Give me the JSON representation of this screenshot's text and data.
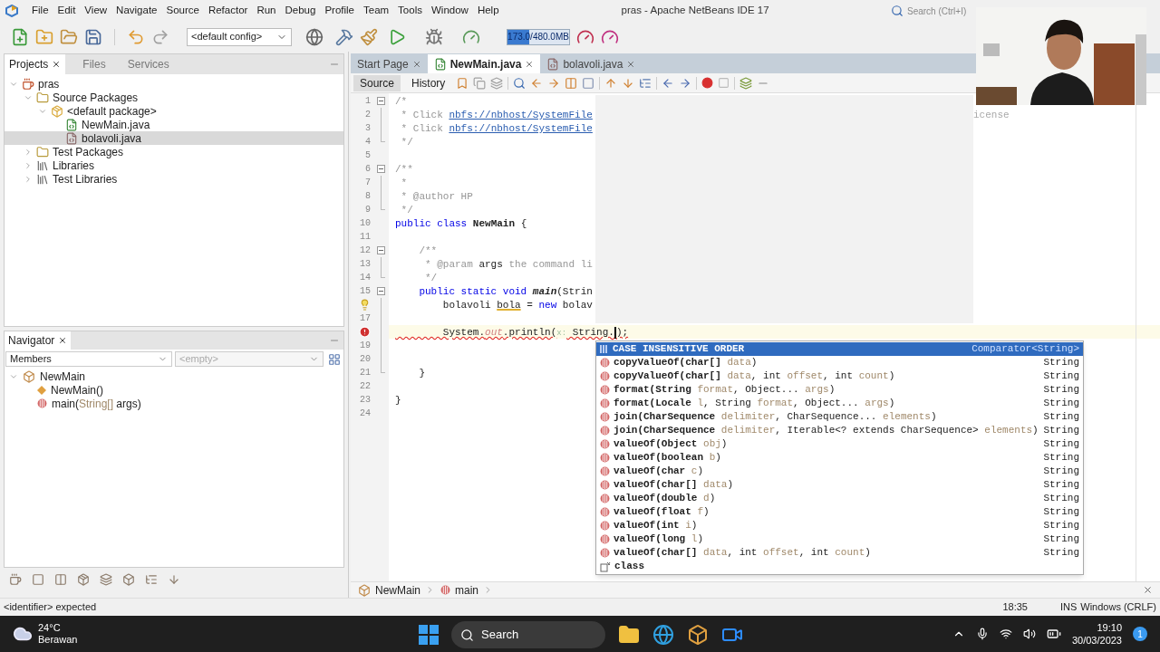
{
  "menu": [
    "File",
    "Edit",
    "View",
    "Navigate",
    "Source",
    "Refactor",
    "Run",
    "Debug",
    "Profile",
    "Team",
    "Tools",
    "Window",
    "Help"
  ],
  "title": "pras - Apache NetBeans IDE 17",
  "search": {
    "placeholder": "Search (Ctrl+I)"
  },
  "toolbar": {
    "config": "<default config>",
    "memory": {
      "text": "173.0/480.0MB",
      "level": 0.36
    }
  },
  "projects": {
    "tabs": [
      {
        "label": "Projects",
        "selected": true
      },
      {
        "label": "Files",
        "selected": false
      },
      {
        "label": "Services",
        "selected": false
      }
    ],
    "tree": [
      {
        "label": "pras",
        "kind": "project",
        "expanded": true,
        "selected": false,
        "children": [
          {
            "label": "Source Packages",
            "kind": "folder",
            "expanded": true,
            "selected": false,
            "children": [
              {
                "label": "<default package>",
                "kind": "package",
                "expanded": true,
                "selected": false,
                "children": [
                  {
                    "label": "NewMain.java",
                    "kind": "mainfile",
                    "selected": false
                  },
                  {
                    "label": "bolavoli.java",
                    "kind": "file",
                    "selected": true
                  }
                ]
              }
            ]
          },
          {
            "label": "Test Packages",
            "kind": "folder",
            "expanded": false,
            "selected": false
          },
          {
            "label": "Libraries",
            "kind": "library",
            "expanded": false,
            "selected": false
          },
          {
            "label": "Test Libraries",
            "kind": "library",
            "expanded": false,
            "selected": false
          }
        ]
      }
    ]
  },
  "navigator": {
    "title": "Navigator",
    "members": {
      "value": "Members",
      "disabled": false
    },
    "filter": {
      "value": "<empty>",
      "disabled": true
    },
    "tree": [
      {
        "parts": [
          {
            "t": "NewMain"
          }
        ],
        "kind": "class",
        "expanded": true,
        "children": [
          {
            "parts": [
              {
                "t": "NewMain()"
              }
            ],
            "kind": "constructor"
          },
          {
            "parts": [
              {
                "t": "main("
              },
              {
                "p": "String[]"
              },
              {
                "t": " args)"
              }
            ],
            "kind": "method"
          }
        ]
      }
    ]
  },
  "editor": {
    "tabs": [
      {
        "label": "Start Page",
        "kind": "page",
        "selected": false
      },
      {
        "label": "NewMain.java",
        "kind": "mainfile",
        "selected": true
      },
      {
        "label": "bolavoli.java",
        "kind": "file",
        "selected": false
      }
    ],
    "views": [
      {
        "label": "Source",
        "selected": true
      },
      {
        "label": "History",
        "selected": false
      }
    ],
    "lines": [
      {
        "number": "1",
        "fold": {
          "kind": "start"
        },
        "current": false,
        "tokens": [
          {
            "kind": "comment",
            "text": "/*"
          }
        ]
      },
      {
        "number": "2",
        "fold": {
          "kind": "line"
        },
        "current": false,
        "tokens": [
          {
            "kind": "comment",
            "text": " * Click "
          },
          {
            "kind": "link",
            "text": "nbfs://nbhost/SystemFile"
          }
        ],
        "tail": "icense"
      },
      {
        "number": "3",
        "fold": {
          "kind": "line"
        },
        "current": false,
        "tokens": [
          {
            "kind": "comment",
            "text": " * Click "
          },
          {
            "kind": "link",
            "text": "nbfs://nbhost/SystemFile"
          }
        ]
      },
      {
        "number": "4",
        "fold": {
          "kind": "end"
        },
        "current": false,
        "tokens": [
          {
            "kind": "comment",
            "text": " */"
          }
        ]
      },
      {
        "number": "5",
        "current": false
      },
      {
        "number": "6",
        "fold": {
          "kind": "start"
        },
        "current": false,
        "tokens": [
          {
            "kind": "comment",
            "text": "/**"
          }
        ]
      },
      {
        "number": "7",
        "fold": {
          "kind": "line"
        },
        "current": false,
        "tokens": [
          {
            "kind": "comment",
            "text": " *"
          }
        ]
      },
      {
        "number": "8",
        "fold": {
          "kind": "line"
        },
        "current": false,
        "tokens": [
          {
            "kind": "comment",
            "text": " * @author HP"
          }
        ]
      },
      {
        "number": "9",
        "fold": {
          "kind": "end"
        },
        "current": false,
        "tokens": [
          {
            "kind": "comment",
            "text": " */"
          }
        ]
      },
      {
        "number": "10",
        "current": false,
        "tokens": [
          {
            "kind": "keyword",
            "text": "public class "
          },
          {
            "kind": "bold",
            "text": "NewMain"
          },
          {
            "kind": "plain",
            "text": " {"
          }
        ]
      },
      {
        "number": "11",
        "current": false
      },
      {
        "number": "12",
        "fold": {
          "kind": "start"
        },
        "current": false,
        "tokens": [
          {
            "kind": "comment",
            "text": "    /**"
          }
        ]
      },
      {
        "number": "13",
        "fold": {
          "kind": "line"
        },
        "current": false,
        "tokens": [
          {
            "kind": "comment",
            "text": "     * @param "
          },
          {
            "kind": "plain",
            "text": "args"
          },
          {
            "kind": "comment",
            "text": " the command li"
          }
        ]
      },
      {
        "number": "14",
        "fold": {
          "kind": "end"
        },
        "current": false,
        "tokens": [
          {
            "kind": "comment",
            "text": "     */"
          }
        ]
      },
      {
        "number": "15",
        "fold": {
          "kind": "start"
        },
        "current": false,
        "tokens": [
          {
            "kind": "keyword",
            "text": "    public static void "
          },
          {
            "kind": "declaration",
            "text": "main"
          },
          {
            "kind": "plain",
            "text": "(Strin"
          }
        ]
      },
      {
        "marker": {
          "kind": "hint"
        },
        "fold": {
          "kind": "line"
        },
        "current": false,
        "tokens": [
          {
            "kind": "plain",
            "text": "        bolavoli "
          },
          {
            "kind": "unused",
            "text": "bola"
          },
          {
            "kind": "plain",
            "text": " = "
          },
          {
            "kind": "keyword",
            "text": "new"
          },
          {
            "kind": "plain",
            "text": " bolav"
          }
        ]
      },
      {
        "number": "17",
        "fold": {
          "kind": "line"
        },
        "current": false
      },
      {
        "marker": {
          "kind": "error"
        },
        "fold": {
          "kind": "line"
        },
        "current": true,
        "tokens": [
          {
            "kind": "plain",
            "text": "        System."
          },
          {
            "kind": "field",
            "text": "out"
          },
          {
            "kind": "plain",
            "text": ".println("
          },
          {
            "kind": "hint",
            "text": "x:"
          },
          {
            "kind": "plain",
            "text": " String."
          },
          {
            "kind": "caret"
          },
          {
            "kind": "plain",
            "text": ");"
          }
        ]
      },
      {
        "number": "19",
        "fold": {
          "kind": "line"
        },
        "current": false
      },
      {
        "number": "20",
        "fold": {
          "kind": "line"
        },
        "current": false
      },
      {
        "number": "21",
        "fold": {
          "kind": "end"
        },
        "current": false,
        "tokens": [
          {
            "kind": "plain",
            "text": "    }"
          }
        ]
      },
      {
        "number": "22",
        "current": false
      },
      {
        "number": "23",
        "current": false,
        "tokens": [
          {
            "kind": "plain",
            "text": "}"
          }
        ]
      },
      {
        "number": "24",
        "current": false
      }
    ],
    "completion": [
      {
        "kind": "field",
        "selected": true,
        "sig": [
          {
            "t": "CASE INSENSITIVE ORDER"
          }
        ],
        "type": "Comparator<String>"
      },
      {
        "kind": "method",
        "selected": false,
        "sig": [
          {
            "t": "copyValueOf(char[] "
          },
          {
            "p": "data"
          },
          {
            "t": ")"
          }
        ],
        "type": "String"
      },
      {
        "kind": "method",
        "selected": false,
        "sig": [
          {
            "t": "copyValueOf(char[] "
          },
          {
            "p": "data"
          },
          {
            "t": ", int "
          },
          {
            "p": "offset"
          },
          {
            "t": ", int "
          },
          {
            "p": "count"
          },
          {
            "t": ")"
          }
        ],
        "type": "String"
      },
      {
        "kind": "method",
        "selected": false,
        "sig": [
          {
            "t": "format(String "
          },
          {
            "p": "format"
          },
          {
            "t": ", Object... "
          },
          {
            "p": "args"
          },
          {
            "t": ")"
          }
        ],
        "type": "String"
      },
      {
        "kind": "method",
        "selected": false,
        "sig": [
          {
            "t": "format(Locale "
          },
          {
            "p": "l"
          },
          {
            "t": ", String "
          },
          {
            "p": "format"
          },
          {
            "t": ", Object... "
          },
          {
            "p": "args"
          },
          {
            "t": ")"
          }
        ],
        "type": "String"
      },
      {
        "kind": "method",
        "selected": false,
        "sig": [
          {
            "t": "join(CharSequence "
          },
          {
            "p": "delimiter"
          },
          {
            "t": ", CharSequence... "
          },
          {
            "p": "elements"
          },
          {
            "t": ")"
          }
        ],
        "type": "String"
      },
      {
        "kind": "method",
        "selected": false,
        "sig": [
          {
            "t": "join(CharSequence "
          },
          {
            "p": "delimiter"
          },
          {
            "t": ", Iterable<? extends CharSequence> "
          },
          {
            "p": "elements"
          },
          {
            "t": ")"
          }
        ],
        "type": "String"
      },
      {
        "kind": "method",
        "selected": false,
        "sig": [
          {
            "t": "valueOf(Object "
          },
          {
            "p": "obj"
          },
          {
            "t": ")"
          }
        ],
        "type": "String"
      },
      {
        "kind": "method",
        "selected": false,
        "sig": [
          {
            "t": "valueOf(boolean "
          },
          {
            "p": "b"
          },
          {
            "t": ")"
          }
        ],
        "type": "String"
      },
      {
        "kind": "method",
        "selected": false,
        "sig": [
          {
            "t": "valueOf(char "
          },
          {
            "p": "c"
          },
          {
            "t": ")"
          }
        ],
        "type": "String"
      },
      {
        "kind": "method",
        "selected": false,
        "sig": [
          {
            "t": "valueOf(char[] "
          },
          {
            "p": "data"
          },
          {
            "t": ")"
          }
        ],
        "type": "String"
      },
      {
        "kind": "method",
        "selected": false,
        "sig": [
          {
            "t": "valueOf(double "
          },
          {
            "p": "d"
          },
          {
            "t": ")"
          }
        ],
        "type": "String"
      },
      {
        "kind": "method",
        "selected": false,
        "sig": [
          {
            "t": "valueOf(float "
          },
          {
            "p": "f"
          },
          {
            "t": ")"
          }
        ],
        "type": "String"
      },
      {
        "kind": "method",
        "selected": false,
        "sig": [
          {
            "t": "valueOf(int "
          },
          {
            "p": "i"
          },
          {
            "t": ")"
          }
        ],
        "type": "String"
      },
      {
        "kind": "method",
        "selected": false,
        "sig": [
          {
            "t": "valueOf(long "
          },
          {
            "p": "l"
          },
          {
            "t": ")"
          }
        ],
        "type": "String"
      },
      {
        "kind": "method",
        "selected": false,
        "sig": [
          {
            "t": "valueOf(char[] "
          },
          {
            "p": "data"
          },
          {
            "t": ", int "
          },
          {
            "p": "offset"
          },
          {
            "t": ", int "
          },
          {
            "p": "count"
          },
          {
            "t": ")"
          }
        ],
        "type": "String"
      },
      {
        "kind": "keyword",
        "selected": false,
        "sig": [
          {
            "t": "class"
          }
        ]
      }
    ],
    "breadcrumb": [
      {
        "label": "NewMain",
        "kind": "class"
      },
      {
        "label": "main",
        "kind": "method"
      }
    ]
  },
  "status": {
    "message": "<identifier> expected",
    "position": "18:35",
    "mode": "INS",
    "line_endings": "Windows (CRLF)"
  },
  "taskbar": {
    "temperature": "24°C",
    "weather": "Berawan",
    "search": "Search",
    "time": "19:10",
    "date": "30/03/2023",
    "badge": "1"
  }
}
